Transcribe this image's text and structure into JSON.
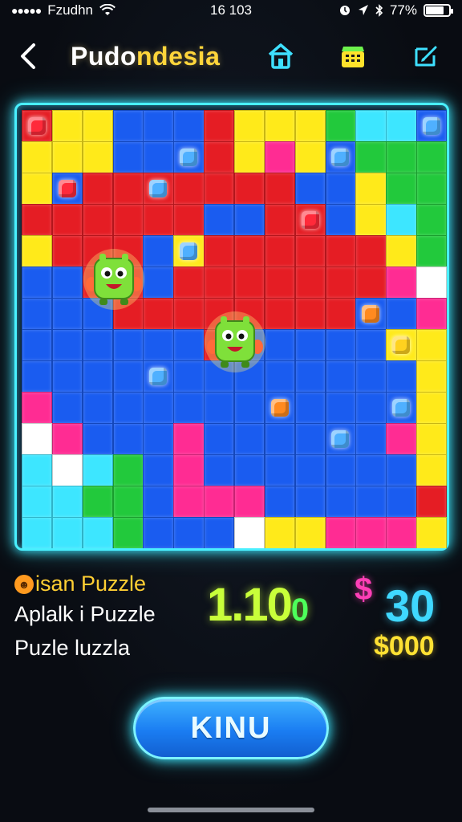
{
  "status_bar": {
    "carrier": "Fzudhn",
    "time": "16 103",
    "battery": "77%",
    "battery_level": 0.77
  },
  "header": {
    "title_part1": "Pudo",
    "title_part2": "ndesia"
  },
  "board": {
    "cols": 14,
    "rows": 14,
    "colors": {
      "R": "#e51d24",
      "Y": "#ffea1a",
      "B": "#1a5cf0",
      "C": "#3de6ff",
      "G": "#22c93c",
      "P": "#ff2c93",
      "W": "#ffffff",
      "O": "#ff7a1a",
      "L": "#c8e83a"
    },
    "grid": [
      "RYYBBBRYYYGCCB",
      "YYYBBBRYPYBGGG",
      "YBRRRRRRRBBYGG",
      "RRRRRRBBRRBYCG",
      "YRRRBYRRRRRRYG",
      "BBRRBRRRRRRRPW",
      "BBBRRRRRRRRBBP",
      "BBBBBBRBBBBBYY",
      "BBBBBBBBBBBBBY",
      "PBBBBBBBBBBBBY",
      "WPBBBPBBBBBBPY",
      "CWCGBPBBBBBBBY",
      "CCGGBPPPBBBBBR",
      "CCCGBBBWYYPPPY"
    ],
    "gems": [
      {
        "col": 0,
        "row": 0,
        "color": "#ff2a3a"
      },
      {
        "col": 13,
        "row": 0,
        "color": "#4fb0ff"
      },
      {
        "col": 5,
        "row": 1,
        "color": "#4fb0ff"
      },
      {
        "col": 10,
        "row": 1,
        "color": "#4fb0ff"
      },
      {
        "col": 1,
        "row": 2,
        "color": "#ff2a3a"
      },
      {
        "col": 4,
        "row": 2,
        "color": "#4fb0ff"
      },
      {
        "col": 9,
        "row": 3,
        "color": "#ff2a3a"
      },
      {
        "col": 5,
        "row": 4,
        "color": "#4fb0ff"
      },
      {
        "col": 11,
        "row": 6,
        "color": "#ff8a1f"
      },
      {
        "col": 12,
        "row": 7,
        "color": "#ffd21f"
      },
      {
        "col": 4,
        "row": 8,
        "color": "#4fb0ff"
      },
      {
        "col": 8,
        "row": 9,
        "color": "#ff8a1f"
      },
      {
        "col": 12,
        "row": 9,
        "color": "#4fb0ff"
      },
      {
        "col": 10,
        "row": 10,
        "color": "#4fb0ff"
      }
    ],
    "monsters": [
      {
        "col": 2,
        "row": 5,
        "color": "#7fe03a"
      },
      {
        "col": 6,
        "row": 7,
        "color": "#7fe03a"
      }
    ]
  },
  "info": {
    "label1": "isan Puzzle",
    "label2": "Aplalk i Puzzle",
    "label3": "Puzle luzzla",
    "score": "1.10",
    "score_suffix": "0",
    "money_symbol": "$",
    "money": "30",
    "money_sub": "$000"
  },
  "main_button": {
    "label": "KINU"
  }
}
